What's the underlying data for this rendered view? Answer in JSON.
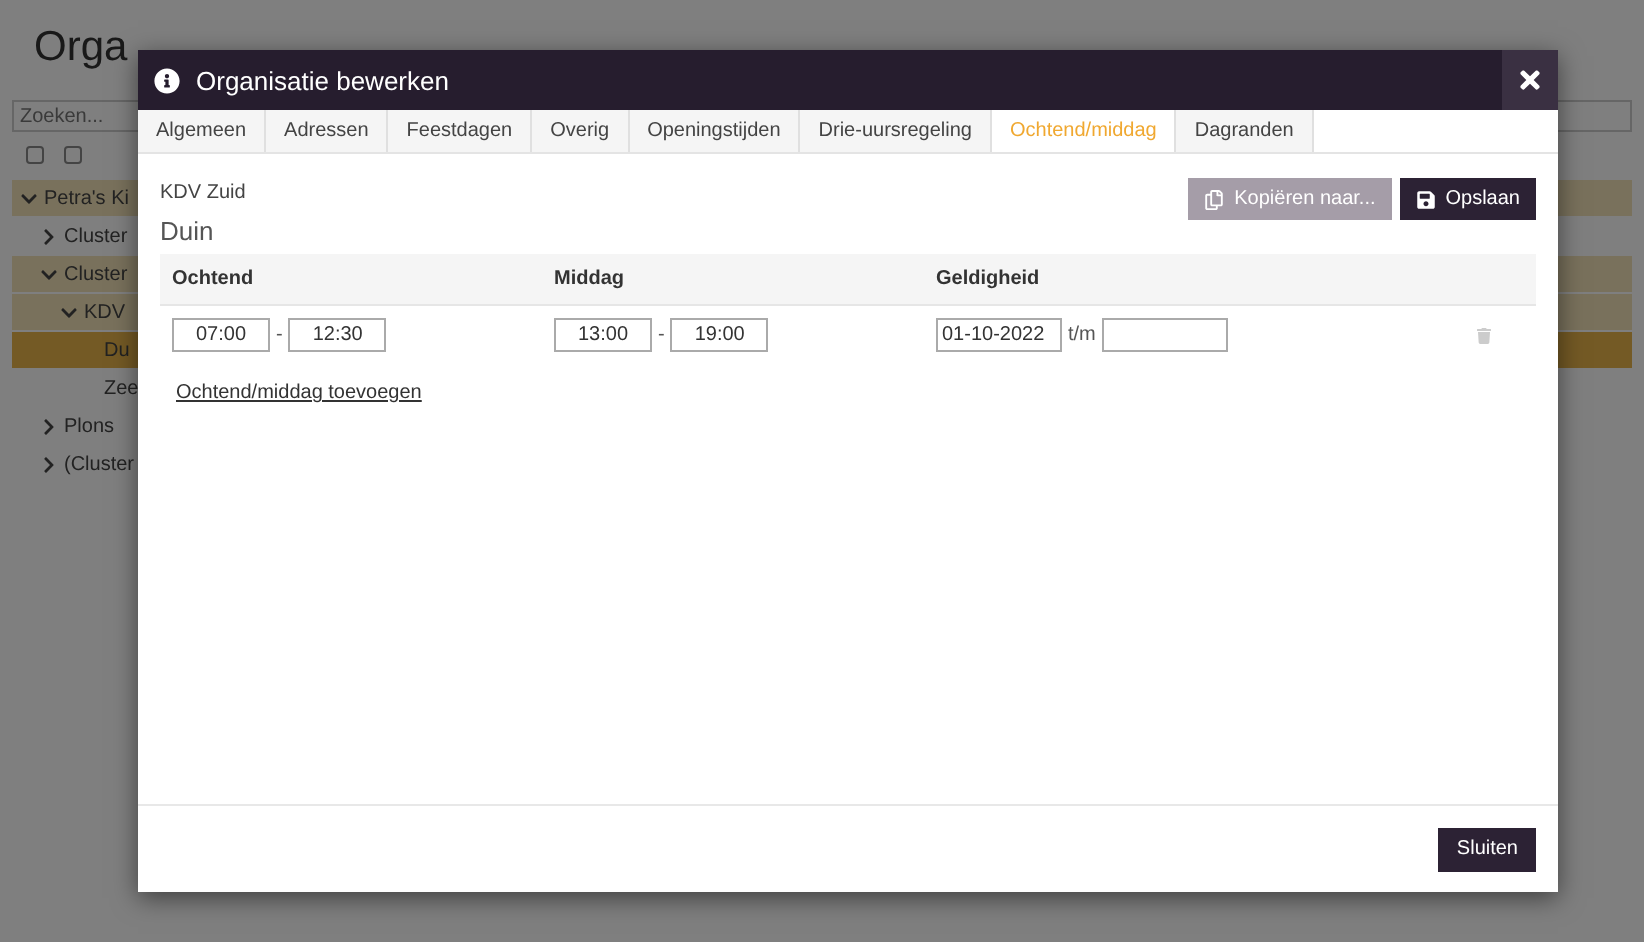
{
  "page": {
    "title": "Orga",
    "search": {
      "placeholder": "Zoeken..."
    },
    "tree": [
      {
        "label": "Petra's Ki",
        "expanded": true,
        "selected": false,
        "highlight": true,
        "children": [
          {
            "label": "Cluster",
            "expanded": false,
            "selected": false,
            "highlight": false
          },
          {
            "label": "Cluster",
            "expanded": true,
            "selected": false,
            "highlight": true,
            "children": [
              {
                "label": "KDV",
                "expanded": true,
                "selected": false,
                "highlight": true,
                "children": [
                  {
                    "label": "Du",
                    "selected": true,
                    "highlight": true
                  },
                  {
                    "label": "Zee",
                    "selected": false,
                    "highlight": false
                  }
                ]
              }
            ]
          },
          {
            "label": "Plons",
            "expanded": false,
            "selected": false,
            "highlight": false
          },
          {
            "label": "(Cluster",
            "expanded": false,
            "selected": false,
            "highlight": false
          }
        ]
      }
    ]
  },
  "dialog": {
    "title": "Organisatie bewerken",
    "tabs": [
      {
        "label": "Algemeen",
        "selected": false
      },
      {
        "label": "Adressen",
        "selected": false
      },
      {
        "label": "Feestdagen",
        "selected": false
      },
      {
        "label": "Overig",
        "selected": false
      },
      {
        "label": "Openingstijden",
        "selected": false
      },
      {
        "label": "Drie-uursregeling",
        "selected": false
      },
      {
        "label": "Ochtend/middag",
        "selected": true
      },
      {
        "label": "Dagranden",
        "selected": false
      }
    ],
    "breadcrumb": "KDV Zuid",
    "heading": "Duin",
    "actions": [
      {
        "label": "Kopiëren naar...",
        "kind": "copy",
        "disabled": true
      },
      {
        "label": "Opslaan",
        "kind": "save",
        "disabled": false
      }
    ],
    "table": {
      "columns": [
        "Ochtend",
        "Middag",
        "Geldigheid"
      ],
      "rows": [
        {
          "ochtend_from": "07:00",
          "ochtend_sep": "-",
          "ochtend_to": "12:30",
          "middag_from": "13:00",
          "middag_sep": "-",
          "middag_to": "19:00",
          "valid_from": "01-10-2022",
          "valid_sep": "t/m"
        }
      ]
    },
    "add_link": "Ochtend/middag toevoegen",
    "close_button": "Sluiten"
  }
}
